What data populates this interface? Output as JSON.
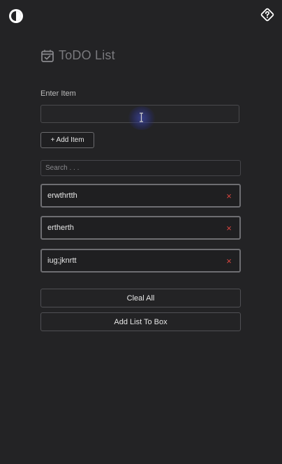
{
  "app": {
    "title": "ToDO List",
    "input_label": "Enter Item",
    "input_value": "",
    "add_button_label": "+ Add Item",
    "search_placeholder": "Search . . ."
  },
  "items": [
    {
      "text": "erwthrtth",
      "delete_label": "×"
    },
    {
      "text": "ertherth",
      "delete_label": "×"
    },
    {
      "text": "iug;jknrtt",
      "delete_label": "×"
    }
  ],
  "actions": {
    "clear_label": "Cleal All",
    "add_list_label": "Add List To Box"
  },
  "icons": {
    "theme_toggle": "half-circle-contrast-icon",
    "help": "question-diamond-icon",
    "title": "calendar-check-icon"
  },
  "colors": {
    "background": "#232325",
    "delete_accent": "#d9453f",
    "title": "#7a7a7e"
  }
}
